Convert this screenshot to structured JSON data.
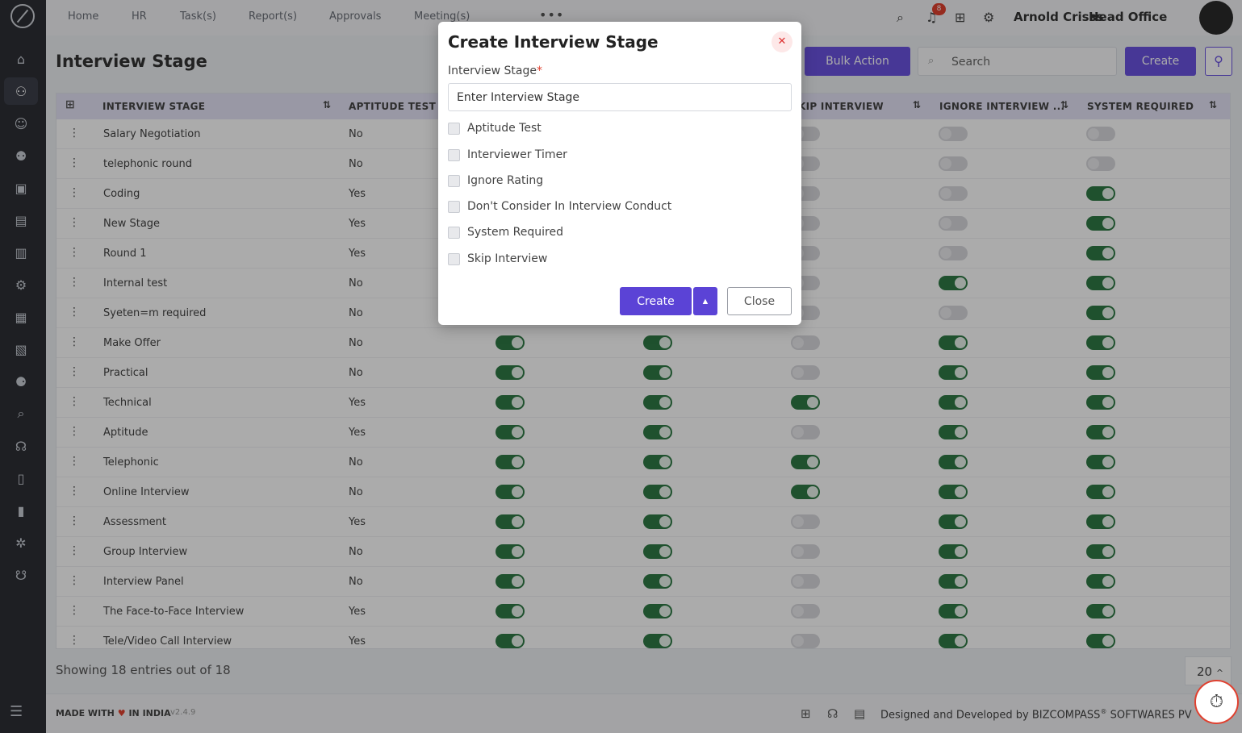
{
  "topnav": {
    "items": [
      "Home",
      "HR",
      "Task(s)",
      "Report(s)",
      "Approvals",
      "Meeting(s)"
    ],
    "more_icon": "ellipsis-icon",
    "notification_count": "8",
    "user_name": "Arnold Crisss",
    "office": "Head Office"
  },
  "page": {
    "title": "Interview Stage",
    "bulk_action_label": "Bulk Action",
    "search_placeholder": "Search",
    "create_label": "Create"
  },
  "table": {
    "columns": [
      "INTERVIEW STAGE",
      "APTITUDE TEST",
      "KIP INTERVIEW",
      "IGNORE INTERVIEW ...",
      "SYSTEM REQUIRED"
    ],
    "rows": [
      {
        "name": "Salary Negotiation",
        "aptitude": "No",
        "t1": false,
        "t2": false,
        "skip": false,
        "ignore": false,
        "system": false
      },
      {
        "name": "telephonic round",
        "aptitude": "No",
        "t1": false,
        "t2": false,
        "skip": false,
        "ignore": false,
        "system": false
      },
      {
        "name": "Coding",
        "aptitude": "Yes",
        "t1": false,
        "t2": false,
        "skip": false,
        "ignore": false,
        "system": true
      },
      {
        "name": "New Stage",
        "aptitude": "Yes",
        "t1": false,
        "t2": false,
        "skip": false,
        "ignore": false,
        "system": true
      },
      {
        "name": "Round 1",
        "aptitude": "Yes",
        "t1": false,
        "t2": false,
        "skip": false,
        "ignore": false,
        "system": true
      },
      {
        "name": "Internal test",
        "aptitude": "No",
        "t1": false,
        "t2": false,
        "skip": false,
        "ignore": true,
        "system": true
      },
      {
        "name": "Syeten=m required",
        "aptitude": "No",
        "t1": false,
        "t2": false,
        "skip": false,
        "ignore": false,
        "system": true
      },
      {
        "name": "Make Offer",
        "aptitude": "No",
        "t1": true,
        "t2": true,
        "skip": false,
        "ignore": true,
        "system": true
      },
      {
        "name": "Practical",
        "aptitude": "No",
        "t1": true,
        "t2": true,
        "skip": false,
        "ignore": true,
        "system": true
      },
      {
        "name": "Technical",
        "aptitude": "Yes",
        "t1": true,
        "t2": true,
        "skip": true,
        "ignore": true,
        "system": true
      },
      {
        "name": "Aptitude",
        "aptitude": "Yes",
        "t1": true,
        "t2": true,
        "skip": false,
        "ignore": true,
        "system": true
      },
      {
        "name": "Telephonic",
        "aptitude": "No",
        "t1": true,
        "t2": true,
        "skip": true,
        "ignore": true,
        "system": true
      },
      {
        "name": "Online Interview",
        "aptitude": "No",
        "t1": true,
        "t2": true,
        "skip": true,
        "ignore": true,
        "system": true
      },
      {
        "name": "Assessment",
        "aptitude": "Yes",
        "t1": true,
        "t2": true,
        "skip": false,
        "ignore": true,
        "system": true
      },
      {
        "name": "Group Interview",
        "aptitude": "No",
        "t1": true,
        "t2": true,
        "skip": false,
        "ignore": true,
        "system": true
      },
      {
        "name": "Interview Panel",
        "aptitude": "No",
        "t1": true,
        "t2": true,
        "skip": false,
        "ignore": true,
        "system": true
      },
      {
        "name": "The Face-to-Face Interview",
        "aptitude": "Yes",
        "t1": true,
        "t2": true,
        "skip": false,
        "ignore": true,
        "system": true
      },
      {
        "name": "Tele/Video Call Interview",
        "aptitude": "Yes",
        "t1": true,
        "t2": true,
        "skip": false,
        "ignore": true,
        "system": true
      }
    ]
  },
  "pagination": {
    "showing_text": "Showing 18 entries out of 18",
    "page_size": "20"
  },
  "footer": {
    "made_with": "MADE WITH",
    "in_india": "IN INDIA",
    "version": "v2.4.9",
    "designed_by": "Designed and Developed by",
    "company": "BIZCOMPASS",
    "company_suffix": "SOFTWARES PV"
  },
  "modal": {
    "title": "Create Interview Stage",
    "field_label": "Interview Stage",
    "field_value": "Enter Interview Stage",
    "checkboxes": [
      "Aptitude Test",
      "Interviewer Timer",
      "Ignore Rating",
      "Don't Consider In Interview Conduct",
      "System Required",
      "Skip Interview"
    ],
    "create_label": "Create",
    "close_label": "Close"
  },
  "colors": {
    "accent": "#6a52e0",
    "toggle_on": "#2f7a45",
    "danger": "#e0402f"
  }
}
